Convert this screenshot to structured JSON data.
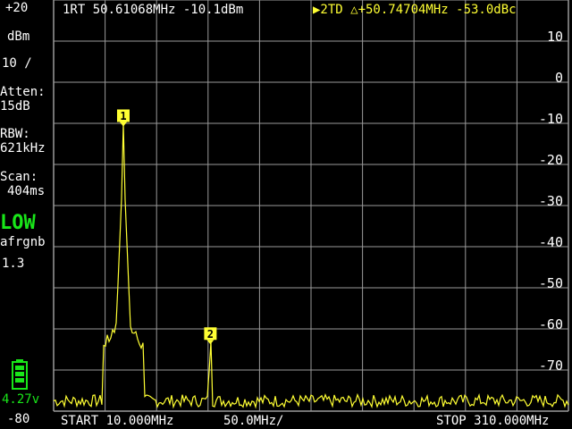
{
  "header": {
    "marker1": "1RT 50.61068MHz -10.1dBm",
    "marker2": "▶2TD △+50.74704MHz -53.0dBc"
  },
  "sidebar": {
    "ref_level": "+20",
    "unit": "dBm",
    "scale": "10 /",
    "atten_label": "Atten:",
    "atten_value": "15dB",
    "rbw_label": "RBW:",
    "rbw_value": "621kHz",
    "scan_label": "Scan:",
    "scan_value": "404ms",
    "mode": "LOW",
    "mode_sub": "afrgnb",
    "version": "1.3",
    "battery_voltage": "4.27v",
    "bottom_level": "-80"
  },
  "footer": {
    "start": "START 10.000MHz",
    "per_div": "50.0MHz/",
    "stop": "STOP 310.000MHz"
  },
  "axis_labels": [
    "20",
    "10",
    "0",
    "-10",
    "-20",
    "-30",
    "-40",
    "-50",
    "-60",
    "-70"
  ],
  "markers": [
    {
      "label": "1",
      "freq_mhz": 50.61068,
      "level_dbm": -10.1
    },
    {
      "label": "2",
      "freq_mhz": 101.35772,
      "level_dbm": -63.1
    }
  ],
  "colors": {
    "trace": "#ffff33",
    "grid": "#9a9a9a",
    "text": "#ffffff",
    "low": "#19e619"
  }
}
